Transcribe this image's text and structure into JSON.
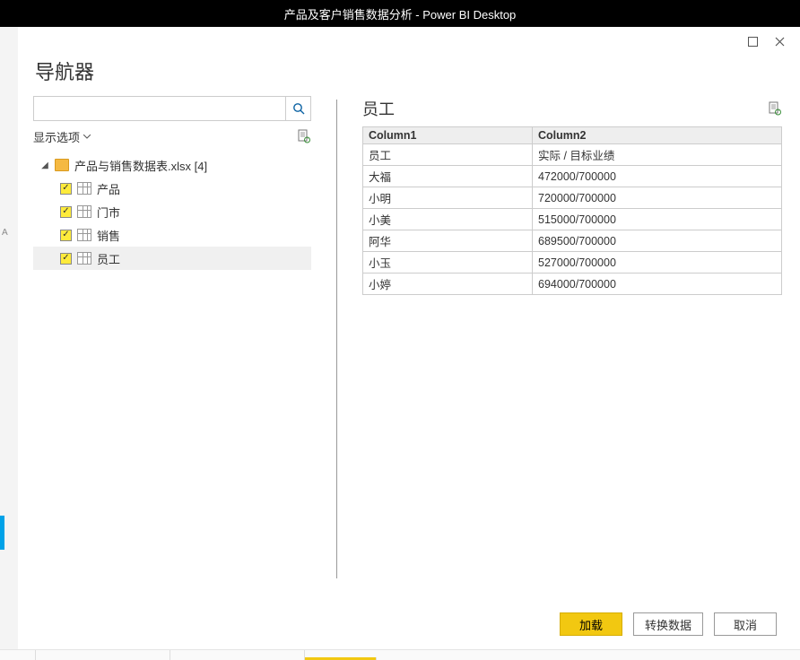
{
  "app_title": "产品及客户销售数据分析 - Power BI Desktop",
  "dialog": {
    "title": "导航器",
    "search_placeholder": "",
    "display_options": "显示选项",
    "file_label": "产品与销售数据表.xlsx [4]",
    "tables": [
      {
        "name": "产品",
        "checked": true
      },
      {
        "name": "门市",
        "checked": true
      },
      {
        "name": "销售",
        "checked": true
      },
      {
        "name": "员工",
        "checked": true,
        "selected": true
      }
    ],
    "preview": {
      "title": "员工",
      "headers": [
        "Column1",
        "Column2"
      ],
      "rows": [
        [
          "员工",
          "实际 / 目标业绩"
        ],
        [
          "大福",
          "472000/700000"
        ],
        [
          "小明",
          "720000/700000"
        ],
        [
          "小美",
          "515000/700000"
        ],
        [
          "阿华",
          "689500/700000"
        ],
        [
          "小玉",
          "527000/700000"
        ],
        [
          "小婷",
          "694000/700000"
        ]
      ]
    },
    "buttons": {
      "load": "加载",
      "transform": "转换数据",
      "cancel": "取消"
    }
  }
}
